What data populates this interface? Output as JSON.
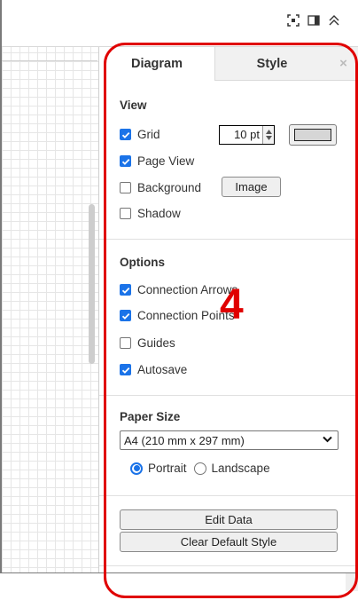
{
  "toolbar": {
    "icons": [
      "fullscreen-icon",
      "format-panel-icon",
      "collapse-icon"
    ]
  },
  "panel": {
    "tabs": [
      {
        "label": "Diagram",
        "active": true
      },
      {
        "label": "Style",
        "active": false
      }
    ],
    "close_label": "×",
    "view": {
      "title": "View",
      "grid": {
        "label": "Grid",
        "checked": true,
        "size_value": "10 pt",
        "color": "#d6d6d6"
      },
      "page_view": {
        "label": "Page View",
        "checked": true
      },
      "background": {
        "label": "Background",
        "checked": false,
        "button_label": "Image"
      },
      "shadow": {
        "label": "Shadow",
        "checked": false
      }
    },
    "options": {
      "title": "Options",
      "items": [
        {
          "label": "Connection Arrows",
          "checked": true
        },
        {
          "label": "Connection Points",
          "checked": true
        },
        {
          "label": "Guides",
          "checked": false
        },
        {
          "label": "Autosave",
          "checked": true
        }
      ]
    },
    "paper": {
      "title": "Paper Size",
      "selected": "A4 (210 mm x 297 mm)",
      "orientation": {
        "portrait_label": "Portrait",
        "landscape_label": "Landscape",
        "selected": "Portrait"
      }
    },
    "actions": {
      "edit_data": "Edit Data",
      "clear_style": "Clear Default Style"
    }
  },
  "annotation": {
    "marker": "4",
    "color": "#e00000"
  },
  "colors": {
    "accent": "#1b73e8",
    "highlight": "#e00000"
  }
}
